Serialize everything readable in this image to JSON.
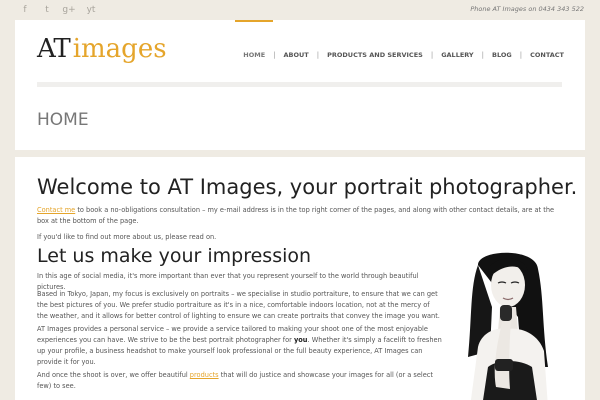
{
  "topbar": {
    "social_icons": [
      "facebook-icon",
      "twitter-icon",
      "google-plus-icon",
      "youtube-icon"
    ],
    "social_glyphs": [
      "f",
      "t",
      "g+",
      "yt"
    ],
    "phone": "Phone AT Images on 0434 343 522"
  },
  "logo": {
    "part1": "AT",
    "part2": "images"
  },
  "nav": {
    "items": [
      "HOME",
      "ABOUT",
      "PRODUCTS AND SERVICES",
      "GALLERY",
      "BLOG",
      "CONTACT"
    ],
    "active": "HOME"
  },
  "page_title": "HOME",
  "content": {
    "heading": "Welcome to AT Images, your portrait photographer.",
    "intro_link": "Contact me",
    "intro_rest": " to book a no-obligations consultation – my e-mail address is in the top right corner of the pages, and along with other contact details, are at the box at the bottom of the page.",
    "about_line": "If you'd like to find out more about us, please read on.",
    "subheading": "Let us make your impression",
    "para1": "In this age of social media, it's more important than ever that you represent yourself to the world through beautiful pictures.",
    "para2": "Based in Tokyo, Japan, my focus is exclusively on portraits – we specialise in studio portraiture, to ensure that we can get the best pictures of you. We prefer studio portraiture as it's in a nice, comfortable indoors location, not at the mercy of the weather, and it allows for better control of lighting to ensure we can create portraits that convey the image you want.",
    "para3_a": "AT Images provides a personal service – we provide a service tailored to making your shoot one of the most enjoyable experiences you can have. We strive to be the best portrait photographer for ",
    "para3_bold": "you",
    "para3_b": ". Whether it's simply a facelift to freshen up your profile, a business headshot to make yourself look professional or the full beauty experience, AT Images can provide it for you.",
    "para4_a": "And once the shoot is over, we offer beautiful ",
    "para4_link": "products",
    "para4_b": " that will do justice and showcase your images for all (or a select few) to see."
  },
  "colors": {
    "accent": "#e5a52b",
    "background": "#efebe3",
    "panel": "#ffffff"
  }
}
